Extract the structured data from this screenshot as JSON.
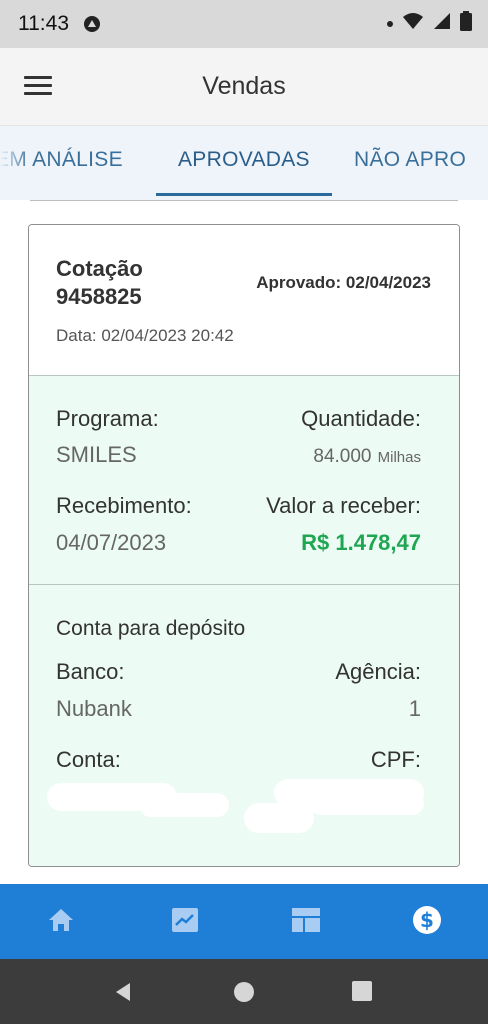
{
  "status_bar": {
    "time": "11:43"
  },
  "app_bar": {
    "title": "Vendas"
  },
  "tabs": [
    {
      "label": "EM ANÁLISE"
    },
    {
      "label": "APROVADAS",
      "active": true
    },
    {
      "label": "NÃO APRO"
    }
  ],
  "card": {
    "title_line1": "Cotação",
    "title_line2": "9458825",
    "approved": "Aprovado: 02/04/2023",
    "date": "Data: 02/04/2023 20:42",
    "programa_label": "Programa:",
    "programa_value": "SMILES",
    "quantidade_label": "Quantidade:",
    "quantidade_value": "84.000",
    "quantidade_unit": "Milhas",
    "recebimento_label": "Recebimento:",
    "recebimento_value": "04/07/2023",
    "valor_label": "Valor a receber:",
    "valor_value": "R$ 1.478,47",
    "deposito_title": "Conta para depósito",
    "banco_label": "Banco:",
    "banco_value": "Nubank",
    "agencia_label": "Agência:",
    "agencia_value": "1",
    "conta_label": "Conta:",
    "cpf_label": "CPF:"
  },
  "bottom_nav": {
    "items": [
      "home-icon",
      "chart-icon",
      "dashboard-icon",
      "dollar-icon"
    ],
    "active": "dollar-icon"
  },
  "colors": {
    "accent": "#1f7fd6",
    "money_green": "#1fa653",
    "section_bg": "#ecfbf3",
    "tabs_bg": "#eef4fa"
  }
}
